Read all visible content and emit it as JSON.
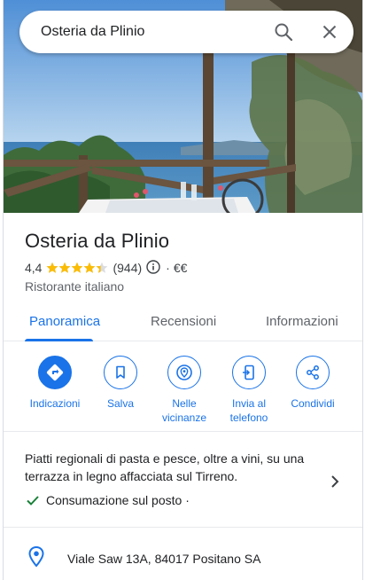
{
  "search": {
    "value": "Osteria da Plinio"
  },
  "place": {
    "title": "Osteria da Plinio",
    "rating": "4,4",
    "stars": 4.4,
    "reviews": "(944)",
    "separator": "·",
    "price": "€€",
    "category": "Ristorante italiano"
  },
  "tabs": [
    {
      "label": "Panoramica",
      "active": true
    },
    {
      "label": "Recensioni",
      "active": false
    },
    {
      "label": "Informazioni",
      "active": false
    }
  ],
  "actions": [
    {
      "label": "Indicazioni",
      "icon": "directions-icon"
    },
    {
      "label": "Salva",
      "icon": "bookmark-icon"
    },
    {
      "label": "Nelle vicinanze",
      "icon": "nearby-icon"
    },
    {
      "label": "Invia al telefono",
      "icon": "send-to-phone-icon"
    },
    {
      "label": "Condividi",
      "icon": "share-icon"
    }
  ],
  "description": {
    "text": "Piatti regionali di pasta e pesce, oltre a vini, su una terrazza in legno affacciata sul Tirreno.",
    "feature": "Consumazione sul posto ·"
  },
  "address": {
    "text": "Viale Saw 13A, 84017 Positano SA"
  },
  "colors": {
    "accent": "#1a73e8",
    "star": "#fbbc04",
    "check": "#188038"
  }
}
